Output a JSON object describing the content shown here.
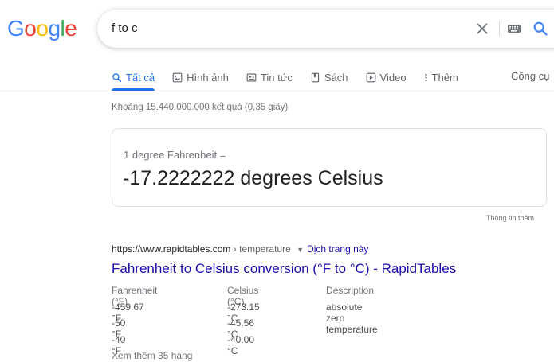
{
  "logo": {
    "letters": [
      "G",
      "o",
      "o",
      "g",
      "l",
      "e"
    ],
    "colors": [
      "#4285f4",
      "#ea4335",
      "#fbbc05",
      "#4285f4",
      "#34a853",
      "#ea4335"
    ]
  },
  "search": {
    "query": "f to c"
  },
  "tabs": [
    {
      "label": "Tất cả",
      "icon": "search-icon",
      "active": true
    },
    {
      "label": "Hình ảnh",
      "icon": "image-icon",
      "active": false
    },
    {
      "label": "Tin tức",
      "icon": "news-icon",
      "active": false
    },
    {
      "label": "Sách",
      "icon": "book-icon",
      "active": false
    },
    {
      "label": "Video",
      "icon": "video-icon",
      "active": false
    },
    {
      "label": "Thêm",
      "icon": "more-vert-icon",
      "active": false
    }
  ],
  "tools_label": "Công cụ",
  "result_stats": "Khoảng 15.440.000.000 kết quả (0,35 giây)",
  "converter": {
    "from_text": "1 degree Fahrenheit =",
    "to_text": "-17.2222222 degrees Celsius"
  },
  "feedback_label": "Thông tin thêm",
  "result": {
    "url": "https://www.rapidtables.com",
    "path": " › temperature",
    "translate_label": "Dịch trang này",
    "title": "Fahrenheit to Celsius conversion (°F to °C) - RapidTables",
    "table": {
      "headers": [
        "Fahrenheit (°F)",
        "Celsius (°C)",
        "Description"
      ],
      "rows": [
        [
          "-459.67 °F",
          "-273.15 °C",
          "absolute zero temperature"
        ],
        [
          "-50 °F",
          "-45.56 °C",
          ""
        ],
        [
          "-40 °F",
          "-40.00 °C",
          ""
        ]
      ]
    },
    "more_rows": "Xem thêm 35 hàng"
  },
  "colors": {
    "accent": "#1a73e8",
    "link": "#1a0dab"
  }
}
